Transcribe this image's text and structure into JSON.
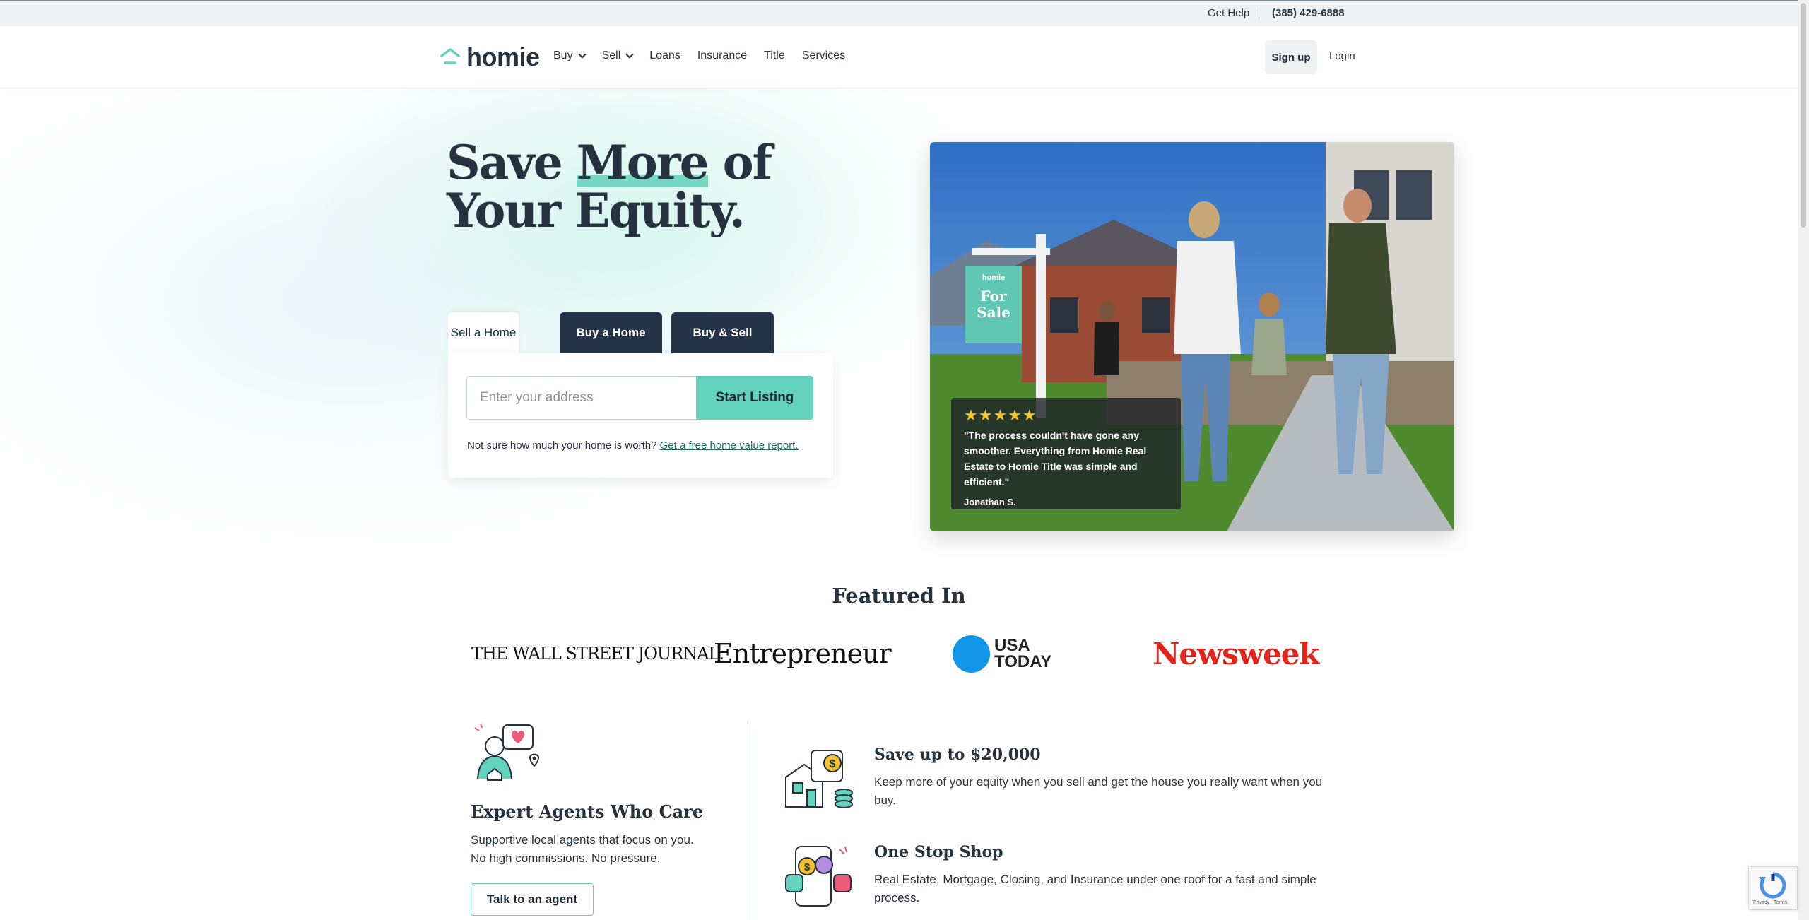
{
  "topbar": {
    "help": "Get Help",
    "phone": "(385) 429-6888"
  },
  "header": {
    "logo": "homie",
    "nav": [
      {
        "label": "Buy",
        "dropdown": true
      },
      {
        "label": "Sell",
        "dropdown": true
      },
      {
        "label": "Loans",
        "dropdown": false
      },
      {
        "label": "Insurance",
        "dropdown": false
      },
      {
        "label": "Title",
        "dropdown": false
      },
      {
        "label": "Services",
        "dropdown": false
      }
    ],
    "signup": "Sign up",
    "login": "Login"
  },
  "hero": {
    "headline_line1_a": "Save ",
    "headline_highlight": "More",
    "headline_line1_b": " of",
    "headline_line2": "Your Equity.",
    "tabs": [
      "Sell a Home",
      "Buy a Home",
      "Buy & Sell"
    ],
    "active_tab": "Sell a Home",
    "address_placeholder": "Enter your address",
    "start_button": "Start Listing",
    "not_sure": "Not sure how much your home is worth? ",
    "report_link": "Get a free home value report.",
    "review": {
      "stars": "★★★★★",
      "quote": "\"The process couldn't have gone any smoother. Everything from Homie Real Estate to Homie Title was simple and efficient.\"",
      "author": "Jonathan S."
    },
    "sign_text": {
      "brand": "homie",
      "line1": "For",
      "line2": "Sale"
    }
  },
  "featured": {
    "title": "Featured In",
    "logos": {
      "wsj": "THE WALL STREET JOURNAL.",
      "entrepreneur": "Entrepreneur",
      "usa_line1": "USA",
      "usa_line2": "TODAY",
      "newsweek": "Newsweek"
    }
  },
  "agents": {
    "title": "Expert Agents Who Care",
    "desc": "Supportive local agents that focus on you. No high commissions. No pressure.",
    "button": "Talk to an agent"
  },
  "features": [
    {
      "title": "Save up to $20,000",
      "desc": "Keep more of your equity when you sell and get the house you really want when you buy.",
      "icon": "house-savings-icon"
    },
    {
      "title": "One Stop Shop",
      "desc": "Real Estate, Mortgage, Closing, and Insurance under one roof for a fast and simple process.",
      "icon": "one-stop-shop-icon"
    }
  ],
  "recaptcha": {
    "text": "Privacy - Terms"
  },
  "colors": {
    "accent": "#63d3bd",
    "navy": "#26344a",
    "text": "#26323f",
    "newsweek": "#e2231a",
    "usa_today": "#1296e8",
    "stars": "#f4c430"
  }
}
